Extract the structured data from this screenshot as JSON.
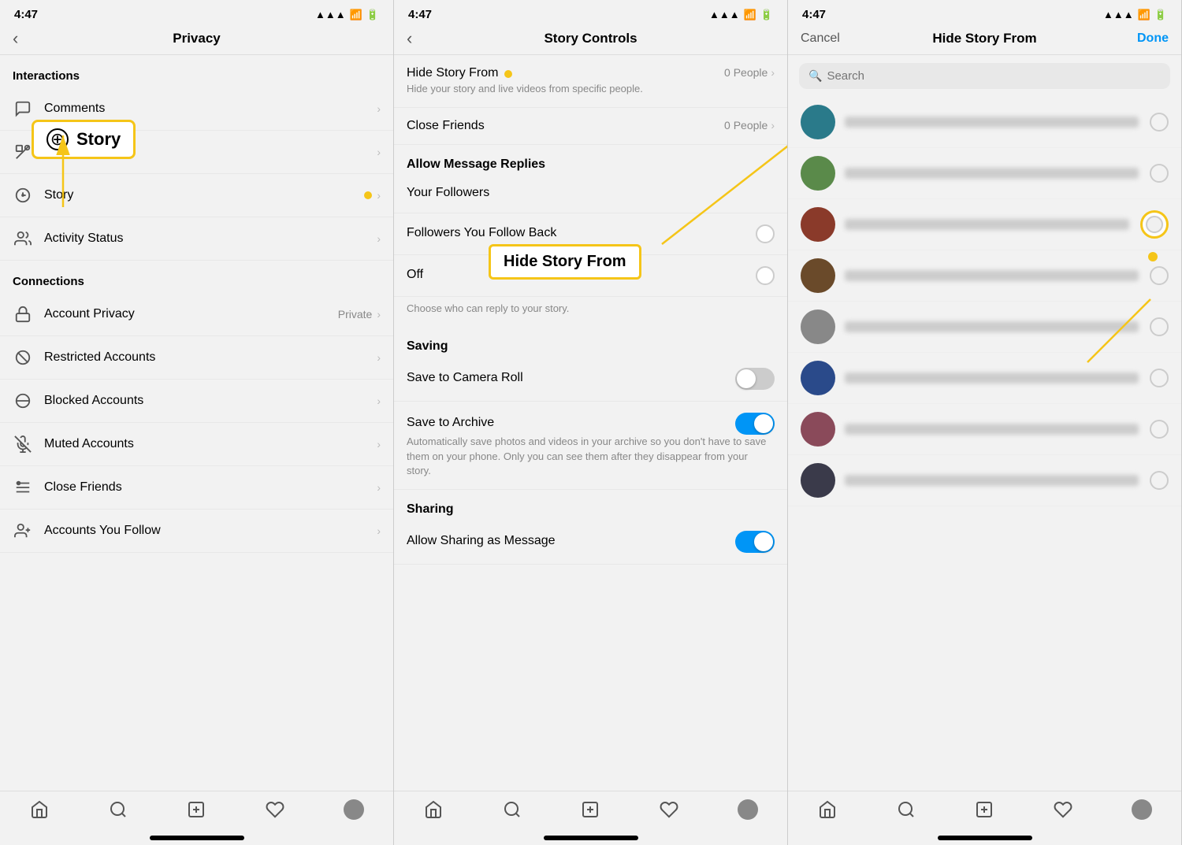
{
  "panels": [
    {
      "id": "privacy",
      "status_time": "4:47",
      "nav": {
        "back": "‹",
        "title": "Privacy"
      },
      "sections": [
        {
          "header": "Interactions",
          "items": [
            {
              "icon": "comment",
              "label": "Comments",
              "badge": ""
            },
            {
              "icon": "tag",
              "label": "Tags",
              "badge": ""
            },
            {
              "icon": "story",
              "label": "Story",
              "badge": "",
              "has_dot": true
            },
            {
              "icon": "activity",
              "label": "Activity Status",
              "badge": ""
            }
          ]
        },
        {
          "header": "Connections",
          "items": [
            {
              "icon": "lock",
              "label": "Account Privacy",
              "badge": "Private"
            },
            {
              "icon": "restrict",
              "label": "Restricted Accounts",
              "badge": ""
            },
            {
              "icon": "block",
              "label": "Blocked Accounts",
              "badge": ""
            },
            {
              "icon": "mute",
              "label": "Muted Accounts",
              "badge": ""
            },
            {
              "icon": "friends",
              "label": "Close Friends",
              "badge": ""
            },
            {
              "icon": "follow",
              "label": "Accounts You Follow",
              "badge": ""
            }
          ]
        }
      ],
      "annotation_story": "Story",
      "tab_bar": [
        "home",
        "search",
        "add",
        "heart",
        "profile"
      ]
    },
    {
      "id": "story-controls",
      "status_time": "4:47",
      "nav": {
        "back": "‹",
        "title": "Story Controls"
      },
      "hide_story_from": {
        "title": "Hide Story From",
        "count": "0 People",
        "subtitle": "Hide your story and live videos from specific people."
      },
      "close_friends": {
        "title": "Close Friends",
        "count": "0 People"
      },
      "allow_message_replies": {
        "section": "Allow Message Replies",
        "options": [
          {
            "label": "Your Followers",
            "type": "radio",
            "selected": true
          },
          {
            "label": "Followers You Follow Back",
            "type": "radio",
            "selected": false
          },
          {
            "label": "Off",
            "type": "radio",
            "selected": false
          }
        ],
        "helper": "Choose who can reply to your story."
      },
      "saving": {
        "section": "Saving",
        "options": [
          {
            "label": "Save to Camera Roll",
            "type": "toggle",
            "on": false
          },
          {
            "label": "Save to Archive",
            "type": "toggle",
            "on": true,
            "subtitle": "Automatically save photos and videos in your archive so you don't have to save them on your phone. Only you can see them after they disappear from your story."
          }
        ]
      },
      "sharing": {
        "section": "Sharing",
        "options": [
          {
            "label": "Allow Sharing as Message",
            "type": "toggle",
            "on": true
          }
        ]
      },
      "annotation": "Hide Story From",
      "tab_bar": [
        "home",
        "search",
        "add",
        "heart",
        "profile"
      ]
    },
    {
      "id": "hide-story-from",
      "status_time": "4:47",
      "nav": {
        "cancel": "Cancel",
        "title": "Hide Story From",
        "done": "Done"
      },
      "search_placeholder": "Search",
      "users": [
        {
          "color": "av-teal"
        },
        {
          "color": "av-green"
        },
        {
          "color": "av-red",
          "highlighted": true
        },
        {
          "color": "av-brown"
        },
        {
          "color": "av-gray"
        },
        {
          "color": "av-blue"
        },
        {
          "color": "av-pink"
        },
        {
          "color": "av-dark"
        }
      ],
      "annotation": "Hide Story From",
      "tab_bar": [
        "home",
        "search",
        "add",
        "heart",
        "profile"
      ]
    }
  ]
}
